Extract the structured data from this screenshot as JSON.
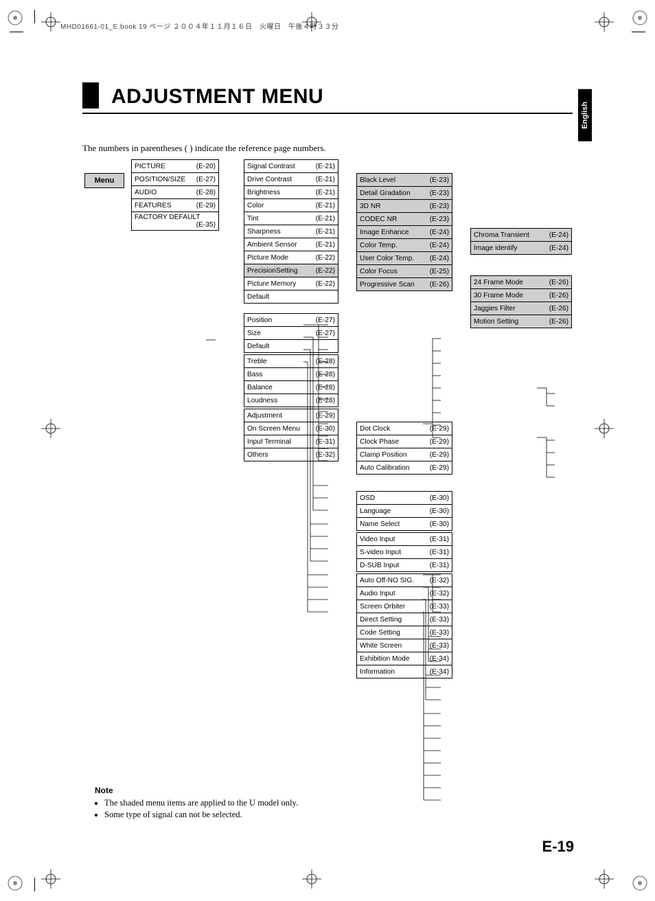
{
  "header_strip": "MHD01661-01_E.book  19 ページ  ２００４年１１月１６日　火曜日　午後４時３３分",
  "lang_tab": "English",
  "title": "ADJUSTMENT MENU",
  "intro": "The numbers in parentheses (   ) indicate the reference page numbers.",
  "root_label": "Menu",
  "col1": [
    {
      "label": "PICTURE",
      "pg": "(E-20)",
      "shaded": false
    },
    {
      "label": "POSITION/SIZE",
      "pg": "(E-27)",
      "shaded": false
    },
    {
      "label": "AUDIO",
      "pg": "(E-28)",
      "shaded": false
    },
    {
      "label": "FEATURES",
      "pg": "(E-29)",
      "shaded": false
    },
    {
      "label": "FACTORY DEFAULT",
      "pg": "(E-35)",
      "shaded": false
    }
  ],
  "col2_groups": [
    [
      {
        "label": "Signal Contrast",
        "pg": "(E-21)"
      },
      {
        "label": "Drive Contrast",
        "pg": "(E-21)"
      },
      {
        "label": "Brightness",
        "pg": "(E-21)"
      },
      {
        "label": "Color",
        "pg": "(E-21)"
      },
      {
        "label": "Tint",
        "pg": "(E-21)"
      },
      {
        "label": "Sharpness",
        "pg": "(E-21)"
      },
      {
        "label": "Ambient Sensor",
        "pg": "(E-21)"
      },
      {
        "label": "Picture Mode",
        "pg": "(E-22)"
      },
      {
        "label": "PrecisionSetting",
        "pg": "(E-22)",
        "shaded": true
      },
      {
        "label": "Picture Memory",
        "pg": "(E-22)"
      },
      {
        "label": "Default",
        "pg": ""
      }
    ],
    [
      {
        "label": "Position",
        "pg": "(E-27)"
      },
      {
        "label": "Size",
        "pg": "(E-27)"
      },
      {
        "label": "Default",
        "pg": ""
      }
    ],
    [
      {
        "label": "Treble",
        "pg": "(E-28)"
      },
      {
        "label": "Bass",
        "pg": "(E-28)"
      },
      {
        "label": "Balance",
        "pg": "(E-28)"
      },
      {
        "label": "Loudness",
        "pg": "(E-28)"
      }
    ],
    [
      {
        "label": "Adjustment",
        "pg": "(E-29)"
      },
      {
        "label": "On Screen Menu",
        "pg": "(E-30)"
      },
      {
        "label": "Input Terminal",
        "pg": "(E-31)"
      },
      {
        "label": "Others",
        "pg": "(E-32)"
      }
    ]
  ],
  "col3_groups": [
    [
      {
        "label": "Black Level",
        "pg": "(E-23)",
        "shaded": true
      },
      {
        "label": "Detail Gradation",
        "pg": "(E-23)",
        "shaded": true
      },
      {
        "label": "3D NR",
        "pg": "(E-23)",
        "shaded": true
      },
      {
        "label": "CODEC NR",
        "pg": "(E-23)",
        "shaded": true
      },
      {
        "label": "Image Enhance",
        "pg": "(E-24)",
        "shaded": true
      },
      {
        "label": "Color Temp.",
        "pg": "(E-24)",
        "shaded": true
      },
      {
        "label": "User Color Temp.",
        "pg": "(E-24)",
        "shaded": true
      },
      {
        "label": "Color Focus",
        "pg": "(E-25)",
        "shaded": true
      },
      {
        "label": "Progressive Scan",
        "pg": "(E-26)",
        "shaded": true
      }
    ],
    [
      {
        "label": "Dot Clock",
        "pg": "(E-29)"
      },
      {
        "label": "Clock Phase",
        "pg": "(E-29)"
      },
      {
        "label": "Clamp Position",
        "pg": "(E-29)"
      },
      {
        "label": "Auto Calibration",
        "pg": "(E-29)"
      }
    ],
    [
      {
        "label": "OSD",
        "pg": "(E-30)"
      },
      {
        "label": "Language",
        "pg": "(E-30)"
      },
      {
        "label": "Name Select",
        "pg": "(E-30)"
      }
    ],
    [
      {
        "label": "Video Input",
        "pg": "(E-31)"
      },
      {
        "label": "S-video Input",
        "pg": "(E-31)"
      },
      {
        "label": "D-SUB Input",
        "pg": "(E-31)"
      }
    ],
    [
      {
        "label": "Auto Off-NO SIG.",
        "pg": "(E-32)"
      },
      {
        "label": "Audio Input",
        "pg": "(E-32)"
      },
      {
        "label": "Screen Orbiter",
        "pg": "(E-33)"
      },
      {
        "label": "Direct Setting",
        "pg": "(E-33)"
      },
      {
        "label": "Code Setting",
        "pg": "(E-33)"
      },
      {
        "label": "White Screen",
        "pg": "(E-33)"
      },
      {
        "label": "Exhibition Mode",
        "pg": "(E-34)"
      },
      {
        "label": "Information",
        "pg": "(E-34)"
      }
    ]
  ],
  "col4_groups": [
    [
      {
        "label": "Chroma Transient",
        "pg": "(E-24)",
        "shaded": true
      },
      {
        "label": "Image identify",
        "pg": "(E-24)",
        "shaded": true
      }
    ],
    [
      {
        "label": "24 Frame Mode",
        "pg": "(E-26)",
        "shaded": true
      },
      {
        "label": "30 Frame Mode",
        "pg": "(E-26)",
        "shaded": true
      },
      {
        "label": "Jaggies Filter",
        "pg": "(E-26)",
        "shaded": true
      },
      {
        "label": "Motion Setting",
        "pg": "(E-26)",
        "shaded": true
      }
    ]
  ],
  "note_heading": "Note",
  "notes": [
    "The shaded menu items are applied to the U model only.",
    "Some type of signal can not be selected."
  ],
  "page_number": "E-19"
}
